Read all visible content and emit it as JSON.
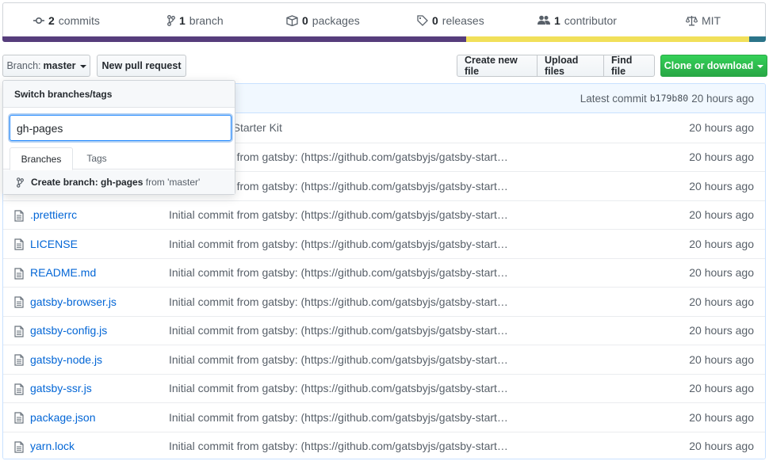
{
  "stats": {
    "commits": {
      "count": "2",
      "label": "commits",
      "icon": "commit-icon"
    },
    "branch": {
      "count": "1",
      "label": "branch",
      "icon": "branch-icon"
    },
    "packages": {
      "count": "0",
      "label": "packages",
      "icon": "package-icon"
    },
    "releases": {
      "count": "0",
      "label": "releases",
      "icon": "tag-icon"
    },
    "contributors": {
      "count": "1",
      "label": "contributor",
      "icon": "people-icon"
    },
    "license": {
      "label": "MIT",
      "icon": "law-icon"
    }
  },
  "language_bar": [
    {
      "color": "#563d7c",
      "share": 0.607
    },
    {
      "color": "#f1e05a",
      "share": 0.371
    },
    {
      "color": "#2b7489",
      "share": 0.022
    }
  ],
  "toolbar": {
    "branch_prefix": "Branch:",
    "branch_name": "master",
    "new_pull_request": "New pull request",
    "create_new_file": "Create new file",
    "upload_files": "Upload files",
    "find_file": "Find file",
    "clone_or_download": "Clone or download"
  },
  "commit_tease": {
    "prefix": "Latest commit",
    "sha": "b179b80",
    "age": "20 hours ago"
  },
  "branch_dropdown": {
    "title": "Switch branches/tags",
    "filter_value": "gh-pages",
    "tab_branches": "Branches",
    "tab_tags": "Tags",
    "create_prefix": "Create branch:",
    "create_name": "gh-pages",
    "create_from_label": "from",
    "create_from_branch": "'master'"
  },
  "files": [
    {
      "name": "",
      "message": "Gatsby Web Starter Kit",
      "age": "20 hours ago"
    },
    {
      "name": "",
      "message": "Initial commit from gatsby: (https://github.com/gatsbyjs/gatsby-start…",
      "age": "20 hours ago"
    },
    {
      "name": "",
      "message": "Initial commit from gatsby: (https://github.com/gatsbyjs/gatsby-start…",
      "age": "20 hours ago"
    },
    {
      "name": ".prettierrc",
      "message": "Initial commit from gatsby: (https://github.com/gatsbyjs/gatsby-start…",
      "age": "20 hours ago"
    },
    {
      "name": "LICENSE",
      "message": "Initial commit from gatsby: (https://github.com/gatsbyjs/gatsby-start…",
      "age": "20 hours ago"
    },
    {
      "name": "README.md",
      "message": "Initial commit from gatsby: (https://github.com/gatsbyjs/gatsby-start…",
      "age": "20 hours ago"
    },
    {
      "name": "gatsby-browser.js",
      "message": "Initial commit from gatsby: (https://github.com/gatsbyjs/gatsby-start…",
      "age": "20 hours ago"
    },
    {
      "name": "gatsby-config.js",
      "message": "Initial commit from gatsby: (https://github.com/gatsbyjs/gatsby-start…",
      "age": "20 hours ago"
    },
    {
      "name": "gatsby-node.js",
      "message": "Initial commit from gatsby: (https://github.com/gatsbyjs/gatsby-start…",
      "age": "20 hours ago"
    },
    {
      "name": "gatsby-ssr.js",
      "message": "Initial commit from gatsby: (https://github.com/gatsbyjs/gatsby-start…",
      "age": "20 hours ago"
    },
    {
      "name": "package.json",
      "message": "Initial commit from gatsby: (https://github.com/gatsbyjs/gatsby-start…",
      "age": "20 hours ago"
    },
    {
      "name": "yarn.lock",
      "message": "Initial commit from gatsby: (https://github.com/gatsbyjs/gatsby-start…",
      "age": "20 hours ago"
    }
  ]
}
